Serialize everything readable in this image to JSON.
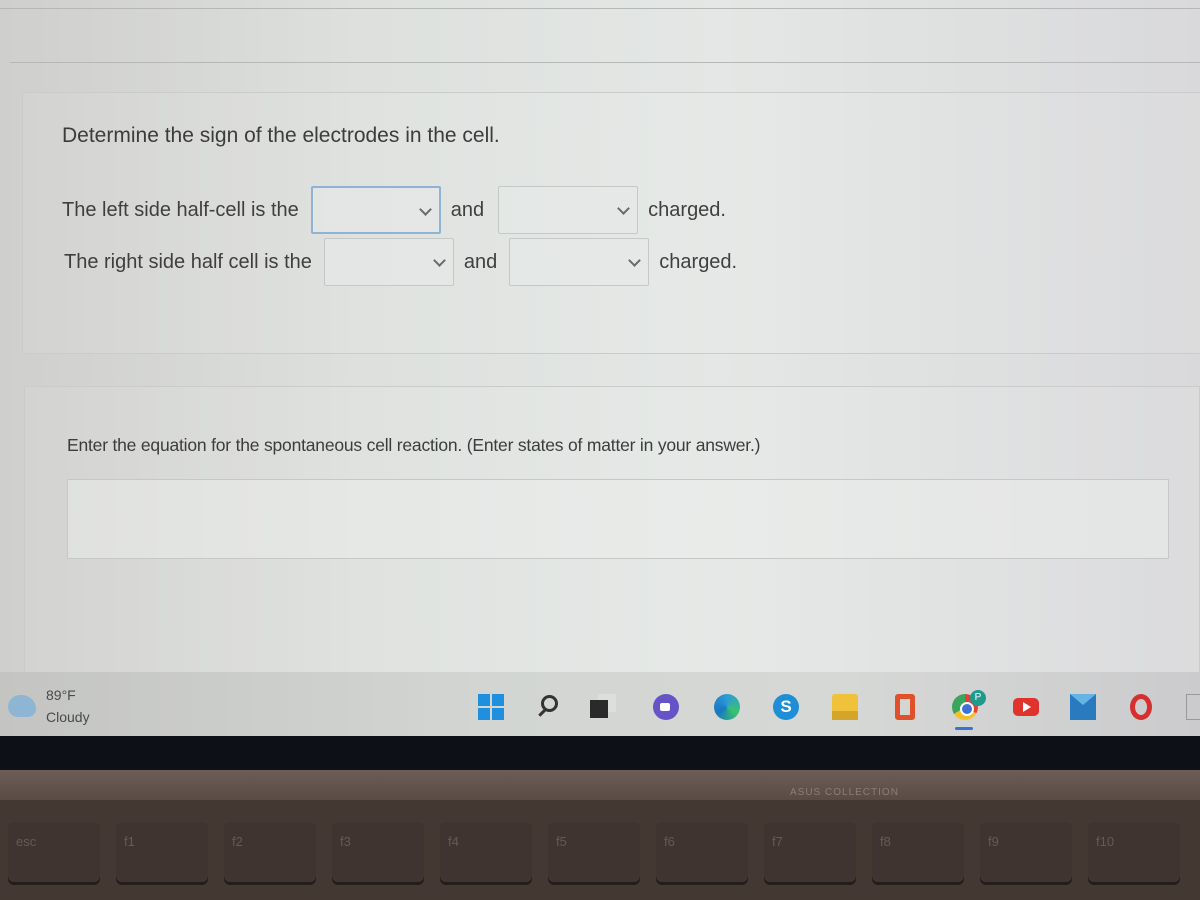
{
  "question": {
    "title": "Determine the sign of the electrodes in the cell.",
    "rows": [
      {
        "prefix": "The left side half-cell is the",
        "select1_value": "",
        "joiner": "and",
        "select2_value": "",
        "suffix": "charged."
      },
      {
        "prefix": "The right side half cell is the",
        "select1_value": "",
        "joiner": "and",
        "select2_value": "",
        "suffix": "charged."
      }
    ],
    "equation_prompt": "Enter the equation for the spontaneous cell reaction. (Enter states of matter in your answer.)",
    "equation_value": ""
  },
  "taskbar": {
    "weather": {
      "temp": "89°F",
      "condition": "Cloudy",
      "icon": "cloud-icon"
    },
    "apps": [
      {
        "name": "start",
        "icon": "windows-icon"
      },
      {
        "name": "search",
        "icon": "search-icon"
      },
      {
        "name": "task-view",
        "icon": "task-view-icon"
      },
      {
        "name": "teams-meet",
        "icon": "video-chat-icon"
      },
      {
        "name": "edge",
        "icon": "edge-icon"
      },
      {
        "name": "skype",
        "icon": "skype-icon",
        "glyph": "S"
      },
      {
        "name": "file-explorer",
        "icon": "folder-icon"
      },
      {
        "name": "office",
        "icon": "office-icon"
      },
      {
        "name": "chrome",
        "icon": "chrome-icon",
        "badge": "P"
      },
      {
        "name": "youtube",
        "icon": "youtube-icon"
      },
      {
        "name": "mail",
        "icon": "mail-icon"
      },
      {
        "name": "opera",
        "icon": "opera-icon"
      }
    ]
  },
  "laptop": {
    "brand": "ASUS COLLECTION",
    "keys": [
      "esc",
      "f1",
      "f2",
      "f3",
      "f4",
      "f5",
      "f6",
      "f7",
      "f8",
      "f9",
      "f10"
    ]
  }
}
